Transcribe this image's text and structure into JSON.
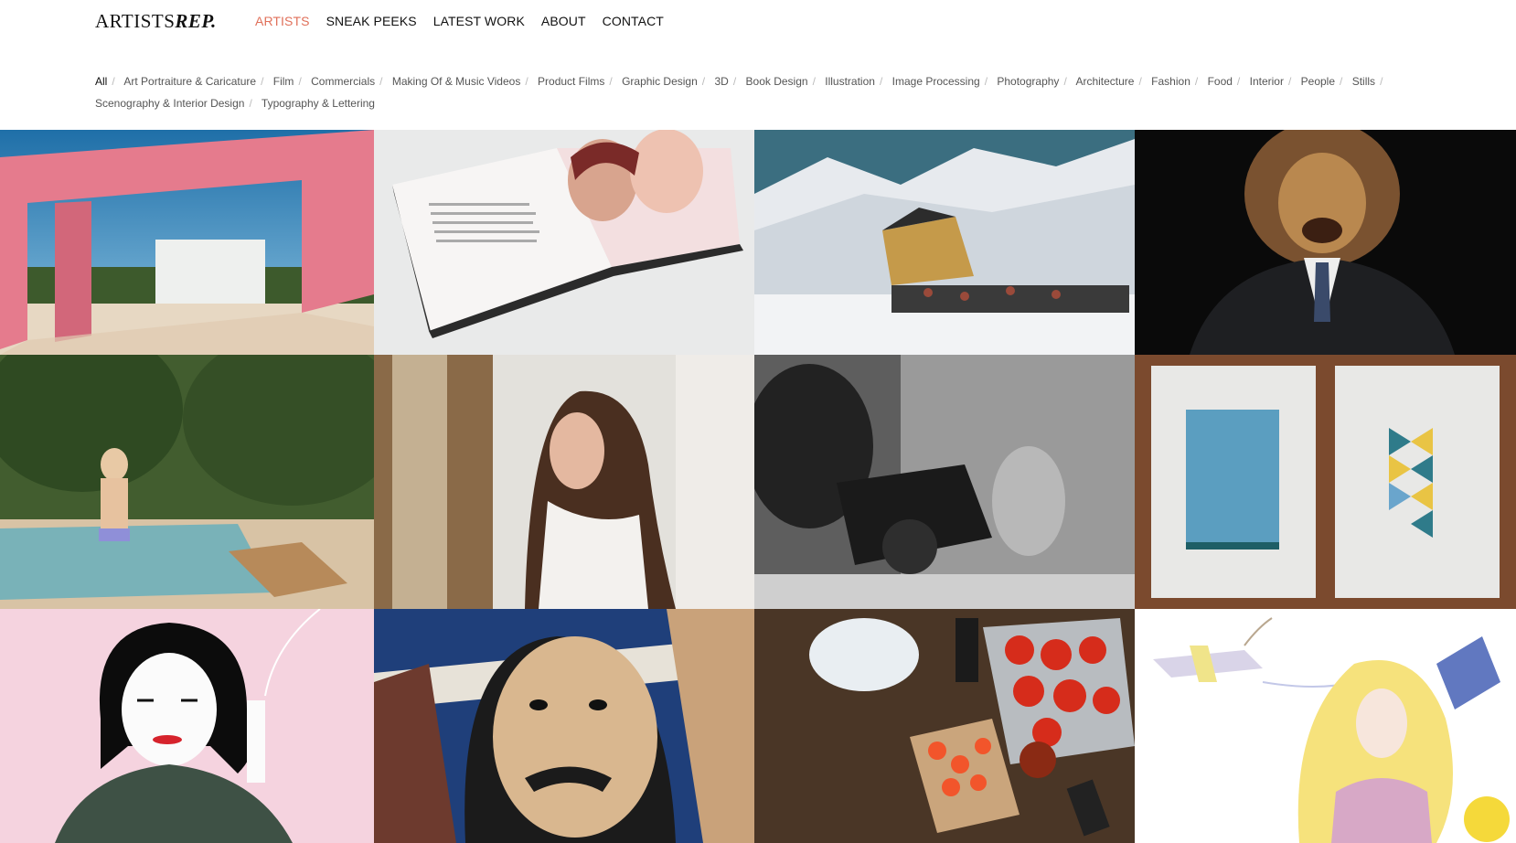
{
  "brand": {
    "part1": "ARTISTS",
    "part2": "REP."
  },
  "nav": [
    {
      "label": "ARTISTS",
      "active": true
    },
    {
      "label": "SNEAK PEEKS"
    },
    {
      "label": "LATEST WORK"
    },
    {
      "label": "ABOUT"
    },
    {
      "label": "CONTACT"
    }
  ],
  "filters": [
    "All",
    "Art Portraiture & Caricature",
    "Film",
    "Commercials",
    "Making Of & Music Videos",
    "Product Films",
    "Graphic Design",
    "3D",
    "Book Design",
    "Illustration",
    "Image Processing",
    "Photography",
    "Architecture",
    "Fashion",
    "Food",
    "Interior",
    "People",
    "Stills",
    "Scenography & Interior Design",
    "Typography & Lettering"
  ],
  "colors": {
    "accent": "#e0705a"
  }
}
